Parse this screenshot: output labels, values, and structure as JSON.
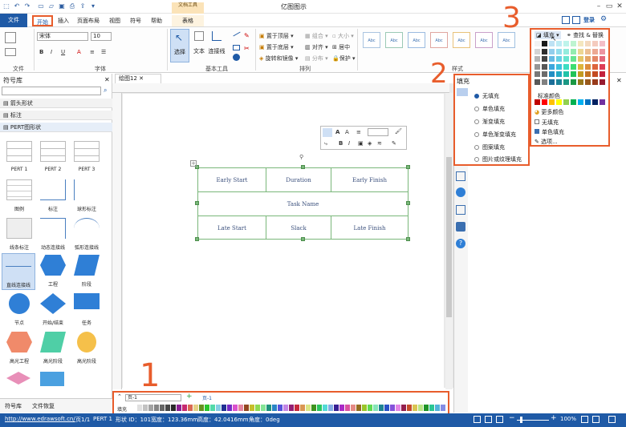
{
  "app": {
    "title": "亿图图示"
  },
  "quick_access": [
    "undo-icon",
    "redo-icon",
    "new-icon",
    "open-icon",
    "save-icon",
    "print-icon",
    "export-icon",
    "more-icon"
  ],
  "header_right": {
    "login": "登录"
  },
  "tabs": {
    "file": "文件",
    "items": [
      "开始",
      "插入",
      "页面布局",
      "视图",
      "符号",
      "帮助",
      "表格"
    ],
    "context_group": "文档工具"
  },
  "ribbon": {
    "file_group_label": "文件",
    "font_group_label": "字体",
    "basic_tools_label": "基本工具",
    "arrange_label": "排列",
    "style_label": "样式",
    "font_name": "宋体",
    "font_size": "10",
    "select": "选择",
    "text": "文本",
    "connector": "连接线",
    "arrange_items": [
      "置于顶层",
      "置于底层",
      "旋转和镜像",
      "组合",
      "对齐",
      "分布",
      "大小",
      "居中",
      "保护"
    ],
    "style_box_text": "Abc"
  },
  "library": {
    "title": "符号库",
    "categories": [
      "箭头形状",
      "标注",
      "PERT图形状"
    ],
    "shapes": [
      "PERT 1",
      "PERT 2",
      "PERT 3",
      "图例",
      "标注",
      "球形标注",
      "线条标注",
      "动态连接线",
      "弧形连接线",
      "直线连接线",
      "工程",
      "阶段",
      "节点",
      "开始/结束",
      "任务",
      "高光工程",
      "高光阶段",
      "高光阶段"
    ],
    "bottom_tabs": [
      "符号库",
      "文件恢复"
    ]
  },
  "document": {
    "tab": "绘图12"
  },
  "diagram": {
    "top_row": [
      "Early Start",
      "Duration",
      "Early Finish"
    ],
    "middle": "Task Name",
    "bottom_row": [
      "Late Start",
      "Slack",
      "Late Finish"
    ]
  },
  "mini_toolbar": {
    "font_a1": "A",
    "font_a2": "A",
    "bold": "B",
    "italic": "I",
    "underline": "U"
  },
  "fill_panel": {
    "title": "填充",
    "options": [
      "无填充",
      "单色填充",
      "渐变填充",
      "单色渐变填充",
      "图案填充",
      "图片或纹理填充"
    ],
    "selected_index": 0
  },
  "color_popup": {
    "tab_fill": "填充",
    "tab_find": "查找 & 替换",
    "standard_colors_label": "标准颜色",
    "more_colors": "更多颜色",
    "no_fill": "无填充",
    "solid_fill": "单色填充",
    "options": "选项..."
  },
  "page_bar": {
    "page_select": "页-1",
    "add": "+",
    "page_tab": "页-1",
    "fill_label": "填充"
  },
  "status": {
    "url": "http://www.edrawsoft.cn/",
    "page": "页1/1",
    "shape": "PERT 1",
    "shape_id": "形状 ID：101",
    "width": "宽度：123.36mm",
    "height": "高度：42.0416mm",
    "angle": "角度：0deg",
    "zoom": "100%"
  },
  "annotations": [
    "1",
    "2",
    "3"
  ],
  "colors": {
    "accent": "#1f5aa6",
    "highlight": "#e85d2c",
    "diagram_border": "#7ab77a",
    "diagram_text": "#3a4f7c"
  }
}
